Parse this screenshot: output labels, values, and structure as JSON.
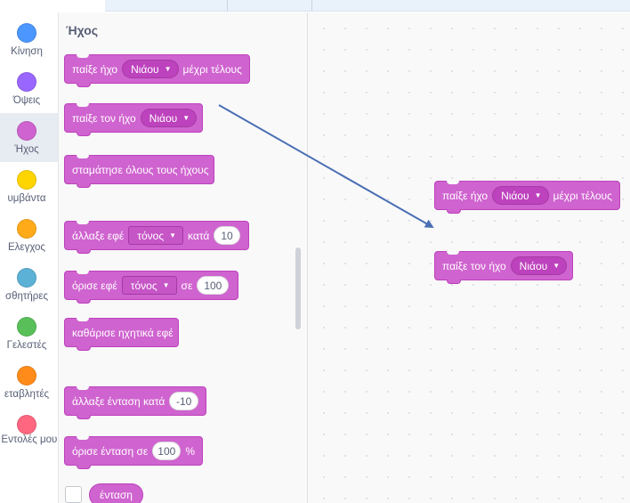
{
  "categories": [
    {
      "label": "Κίνηση",
      "color": "#4c97ff"
    },
    {
      "label": "Όψεις",
      "color": "#9966ff"
    },
    {
      "label": "Ήχος",
      "color": "#cf63cf",
      "active": true
    },
    {
      "label": "υμβάντα",
      "color": "#ffd500"
    },
    {
      "label": "Ελεγχος",
      "color": "#ffab19"
    },
    {
      "label": "σθητήρες",
      "color": "#5cb1d6"
    },
    {
      "label": "Γελεστές",
      "color": "#59c059"
    },
    {
      "label": "εταβλητές",
      "color": "#ff8c1a"
    },
    {
      "label": "ι Εντολές μου",
      "color": "#ff6680"
    }
  ],
  "flyout": {
    "title": "Ήχος",
    "play_until_done": {
      "text1": "παίξε ήχο",
      "menu": "Νιάου",
      "text2": "μέχρι τέλους"
    },
    "start_sound": {
      "text1": "παίξε τον ήχο",
      "menu": "Νιάου"
    },
    "stop_all": {
      "text1": "σταμάτησε όλους τους ήχους"
    },
    "change_effect": {
      "text1": "άλλαξε εφέ",
      "menu": "τόνος",
      "text2": "κατά",
      "value": "10"
    },
    "set_effect": {
      "text1": "όρισε εφέ",
      "menu": "τόνος",
      "text2": "σε",
      "value": "100"
    },
    "clear_effects": {
      "text1": "καθάρισε ηχητικά εφέ"
    },
    "change_volume": {
      "text1": "άλλαξε ένταση κατά",
      "value": "-10"
    },
    "set_volume": {
      "text1": "όρισε ένταση σε",
      "value": "100",
      "text2": "%"
    },
    "volume_reporter": {
      "text1": "ένταση"
    }
  },
  "canvas": {
    "block1": {
      "text1": "παίξε ήχο",
      "menu": "Νιάου",
      "text2": "μέχρι τέλους"
    },
    "block2": {
      "text1": "παίξε τον ήχο",
      "menu": "Νιάου"
    }
  },
  "colors": {
    "sound_block": "#cf63cf",
    "sound_border": "#bd42bd",
    "arrow": "#4a6fb5"
  }
}
